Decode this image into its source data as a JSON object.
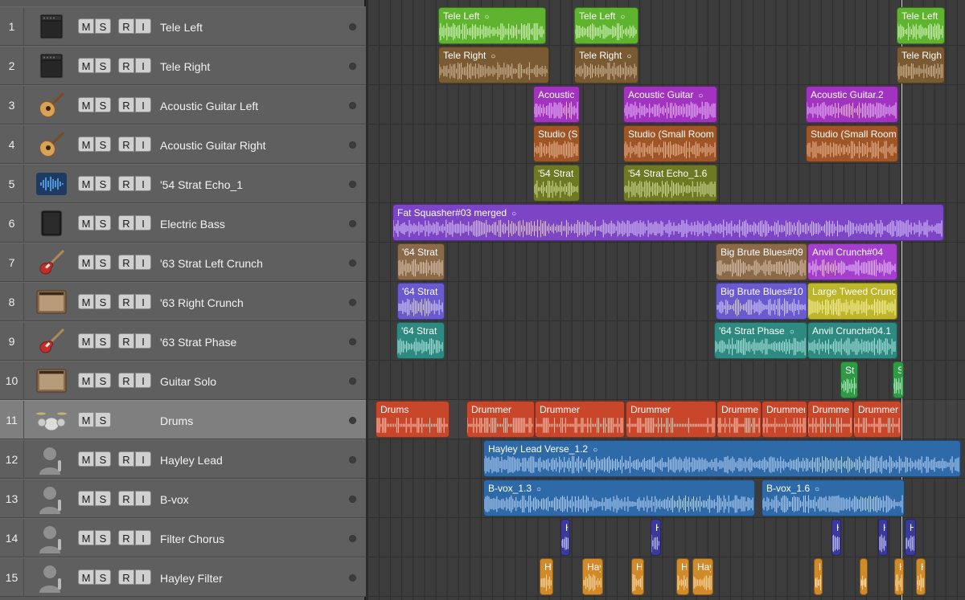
{
  "tracks": [
    {
      "num": "1",
      "name": "Tele Left",
      "icon": "amp-head-icon",
      "rec": true
    },
    {
      "num": "2",
      "name": "Tele Right",
      "icon": "amp-head-icon",
      "rec": true
    },
    {
      "num": "3",
      "name": "Acoustic Guitar Left",
      "icon": "acoustic-guitar-icon",
      "rec": true
    },
    {
      "num": "4",
      "name": "Acoustic Guitar Right",
      "icon": "acoustic-guitar-icon",
      "rec": true
    },
    {
      "num": "5",
      "name": "'54 Strat Echo_1",
      "icon": "waveform-icon",
      "rec": true
    },
    {
      "num": "6",
      "name": "Electric Bass",
      "icon": "bass-amp-icon",
      "rec": true
    },
    {
      "num": "7",
      "name": "'63 Strat Left Crunch",
      "icon": "electric-guitar-icon",
      "rec": true
    },
    {
      "num": "8",
      "name": "'63 Right Crunch",
      "icon": "combo-amp-icon",
      "rec": true
    },
    {
      "num": "9",
      "name": "'63 Strat Phase",
      "icon": "electric-guitar-icon",
      "rec": true
    },
    {
      "num": "10",
      "name": "Guitar Solo",
      "icon": "combo-amp-icon",
      "rec": true
    },
    {
      "num": "11",
      "name": "Drums",
      "icon": "drum-kit-icon",
      "rec": false
    },
    {
      "num": "12",
      "name": "Hayley Lead",
      "icon": "singer-icon",
      "rec": true
    },
    {
      "num": "13",
      "name": "B-vox",
      "icon": "singer-icon",
      "rec": true
    },
    {
      "num": "14",
      "name": "Filter Chorus",
      "icon": "singer-icon",
      "rec": true
    },
    {
      "num": "15",
      "name": "Hayley Filter",
      "icon": "singer-icon",
      "rec": true
    }
  ],
  "buttons": {
    "mute": "M",
    "solo": "S",
    "record": "R",
    "input": "I"
  },
  "regions": [
    {
      "track": 0,
      "label": "Tele Left",
      "loop": true,
      "color": "#5fb32e",
      "wave": "#e8ffd8"
    },
    {
      "track": 0,
      "label": "Tele Left",
      "loop": true,
      "color": "#5fb32e",
      "wave": "#e8ffd8"
    },
    {
      "track": 0,
      "label": "Tele Left",
      "loop": false,
      "color": "#5fb32e",
      "wave": "#e8ffd8"
    },
    {
      "track": 1,
      "label": "Tele Right",
      "loop": true,
      "color": "#7a5a32",
      "wave": "#d8c3a3"
    },
    {
      "track": 1,
      "label": "Tele Right",
      "loop": true,
      "color": "#7a5a32",
      "wave": "#d8c3a3"
    },
    {
      "track": 1,
      "label": "Tele Righ",
      "loop": false,
      "color": "#7a5a32",
      "wave": "#d8c3a3"
    },
    {
      "track": 2,
      "label": "Acoustic",
      "loop": false,
      "color": "#a232c0",
      "wave": "#f0c8ff"
    },
    {
      "track": 2,
      "label": "Acoustic Guitar",
      "loop": true,
      "color": "#a232c0",
      "wave": "#f0c8ff"
    },
    {
      "track": 2,
      "label": "Acoustic Guitar.2",
      "loop": false,
      "color": "#a232c0",
      "wave": "#f0c8ff"
    },
    {
      "track": 3,
      "label": "Studio (S",
      "loop": false,
      "color": "#a05526",
      "wave": "#f0c0a0"
    },
    {
      "track": 3,
      "label": "Studio (Small Room",
      "loop": false,
      "color": "#a05526",
      "wave": "#f0c0a0"
    },
    {
      "track": 3,
      "label": "Studio (Small Room",
      "loop": false,
      "color": "#a05526",
      "wave": "#f0c0a0"
    },
    {
      "track": 4,
      "label": "'54 Strat",
      "loop": false,
      "color": "#6d7a23",
      "wave": "#dfe8a5"
    },
    {
      "track": 4,
      "label": "'54 Strat Echo_1.6",
      "loop": false,
      "color": "#6d7a23",
      "wave": "#dfe8a5"
    },
    {
      "track": 5,
      "label": "Fat Squasher#03 merged",
      "loop": true,
      "color": "#7b45c6",
      "wave": "#e6d6ff"
    },
    {
      "track": 6,
      "label": "'64 Strat",
      "loop": false,
      "color": "#8b6a4a",
      "wave": "#e6d1bc"
    },
    {
      "track": 6,
      "label": "Big Brute Blues#09",
      "loop": false,
      "color": "#8b6a4a",
      "wave": "#e6d1bc"
    },
    {
      "track": 6,
      "label": "Anvil Crunch#04",
      "loop": false,
      "color": "#a33fcc",
      "wave": "#f3d2ff"
    },
    {
      "track": 7,
      "label": "'64 Strat",
      "loop": false,
      "color": "#6a5ad0",
      "wave": "#e4dfff"
    },
    {
      "track": 7,
      "label": "Big Brute Blues#10",
      "loop": false,
      "color": "#6a5ad0",
      "wave": "#e4dfff"
    },
    {
      "track": 7,
      "label": "Large Tweed Crunch",
      "loop": false,
      "color": "#bdb52a",
      "wave": "#fffab0"
    },
    {
      "track": 8,
      "label": "'64 Strat",
      "loop": false,
      "color": "#2e8a80",
      "wave": "#bff0ea"
    },
    {
      "track": 8,
      "label": "'64 Strat Phase",
      "loop": true,
      "color": "#2e8a80",
      "wave": "#bff0ea"
    },
    {
      "track": 8,
      "label": "Anvil Crunch#04.1",
      "loop": false,
      "color": "#2e8a80",
      "wave": "#bff0ea"
    },
    {
      "track": 9,
      "label": "St",
      "loop": false,
      "color": "#2e9a45",
      "wave": "#c8f5d2"
    },
    {
      "track": 9,
      "label": "S",
      "loop": false,
      "color": "#2e9a45",
      "wave": "#c8f5d2"
    },
    {
      "track": 10,
      "label": "Drums",
      "loop": false,
      "color": "#c8462a",
      "wave": "#ffd6c8"
    },
    {
      "track": 10,
      "label": "Drummer",
      "loop": false,
      "color": "#c8462a",
      "wave": "#ffd6c8"
    },
    {
      "track": 10,
      "label": "Drummer",
      "loop": false,
      "color": "#c8462a",
      "wave": "#ffd6c8"
    },
    {
      "track": 10,
      "label": "Drummer",
      "loop": false,
      "color": "#c8462a",
      "wave": "#ffd6c8"
    },
    {
      "track": 10,
      "label": "Drumme",
      "loop": false,
      "color": "#c8462a",
      "wave": "#ffd6c8"
    },
    {
      "track": 10,
      "label": "Drummer",
      "loop": false,
      "color": "#c8462a",
      "wave": "#ffd6c8"
    },
    {
      "track": 10,
      "label": "Drumme",
      "loop": false,
      "color": "#c8462a",
      "wave": "#ffd6c8"
    },
    {
      "track": 10,
      "label": "Drummer",
      "loop": false,
      "color": "#c8462a",
      "wave": "#ffd6c8"
    },
    {
      "track": 11,
      "label": "Hayley Lead Verse_1.2",
      "loop": true,
      "color": "#2f6aa8",
      "wave": "#c9e0ff"
    },
    {
      "track": 12,
      "label": "B-vox_1.3",
      "loop": true,
      "color": "#2f6aa8",
      "wave": "#c9e0ff"
    },
    {
      "track": 12,
      "label": "B-vox_1.6",
      "loop": true,
      "color": "#2f6aa8",
      "wave": "#c9e0ff"
    },
    {
      "track": 13,
      "label": "H",
      "loop": false,
      "color": "#3a3a9a",
      "wave": "#d0d0ff"
    },
    {
      "track": 13,
      "label": "H",
      "loop": false,
      "color": "#3a3a9a",
      "wave": "#d0d0ff"
    },
    {
      "track": 13,
      "label": "H",
      "loop": false,
      "color": "#3a3a9a",
      "wave": "#d0d0ff"
    },
    {
      "track": 13,
      "label": "H",
      "loop": false,
      "color": "#3a3a9a",
      "wave": "#d0d0ff"
    },
    {
      "track": 13,
      "label": "H",
      "loop": false,
      "color": "#3a3a9a",
      "wave": "#d0d0ff"
    },
    {
      "track": 14,
      "label": "H",
      "loop": false,
      "color": "#d08a2a",
      "wave": "#ffe2b5"
    },
    {
      "track": 14,
      "label": "Hay",
      "loop": false,
      "color": "#d08a2a",
      "wave": "#ffe2b5"
    },
    {
      "track": 14,
      "label": "H",
      "loop": false,
      "color": "#d08a2a",
      "wave": "#ffe2b5"
    },
    {
      "track": 14,
      "label": "H",
      "loop": false,
      "color": "#d08a2a",
      "wave": "#ffe2b5"
    },
    {
      "track": 14,
      "label": "Hay",
      "loop": false,
      "color": "#d08a2a",
      "wave": "#ffe2b5"
    },
    {
      "track": 14,
      "label": "H",
      "loop": false,
      "color": "#d08a2a",
      "wave": "#ffe2b5"
    },
    {
      "track": 14,
      "label": "H",
      "loop": false,
      "color": "#d08a2a",
      "wave": "#ffe2b5"
    },
    {
      "track": 14,
      "label": "H",
      "loop": false,
      "color": "#d08a2a",
      "wave": "#ffe2b5"
    },
    {
      "track": 14,
      "label": "H",
      "loop": false,
      "color": "#d08a2a",
      "wave": "#ffe2b5"
    }
  ],
  "selected_track": 10
}
